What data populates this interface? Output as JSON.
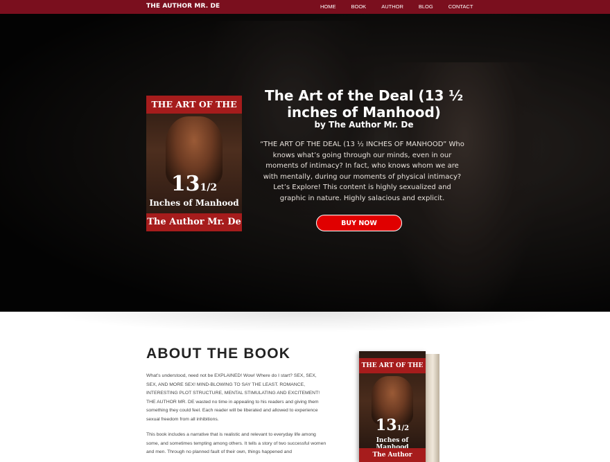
{
  "nav": {
    "brand": "THE AUTHOR MR. DE",
    "links": [
      "HOME",
      "BOOK",
      "AUTHOR",
      "BLOG",
      "CONTACT"
    ]
  },
  "hero": {
    "cover": {
      "title": "THE ART OF THE DEAL",
      "number": "13",
      "fraction": "1/2",
      "subtitle": "Inches of Manhood",
      "author": "The Author Mr. De"
    },
    "title": "The Art of the Deal (13 ½ inches of Manhood)",
    "author": "by The Author Mr. De",
    "description": "“THE ART OF THE DEAL (13 ½ INCHES OF MANHOOD” Who knows what’s going through our minds, even in our moments of intimacy? In fact, who knows whom we are with mentally, during our moments of physical intimacy? Let’s Explore! This content is highly sexualized and graphic in nature. Highly salacious and explicit.",
    "buy_label": "BUY NOW",
    "accent": "#e00000"
  },
  "about": {
    "heading": "ABOUT THE BOOK",
    "paragraph1": "What’s understood, need not be EXPLAINED! Wow! Where do I start? SEX, SEX, SEX, AND MORE SEX! MIND-BLOWING TO SAY THE LEAST. ROMANCE, INTERESTING PLOT STRUCTURE, MENTAL STIMULATING AND EXCITEMENT! THE AUTHOR MR. DE wasted no time in appealing to his readers and giving them something they could feel. Each reader will be liberated and allowed to experience sexual freedom from all inhibitions.",
    "paragraph2": "This book includes a narrative that is realistic and relevant to everyday life among some, and sometimes tempting among others. It tells a story of two successful women and men. Through no planned fault of their own, things happened and",
    "book": {
      "title": "THE ART OF THE DEAL",
      "number": "13",
      "fraction": "1/2",
      "subtitle": "Inches of Manhood",
      "author": "The Author"
    }
  },
  "colors": {
    "nav_bg": "#7a0f1e",
    "cover_red": "#a61c1c"
  }
}
